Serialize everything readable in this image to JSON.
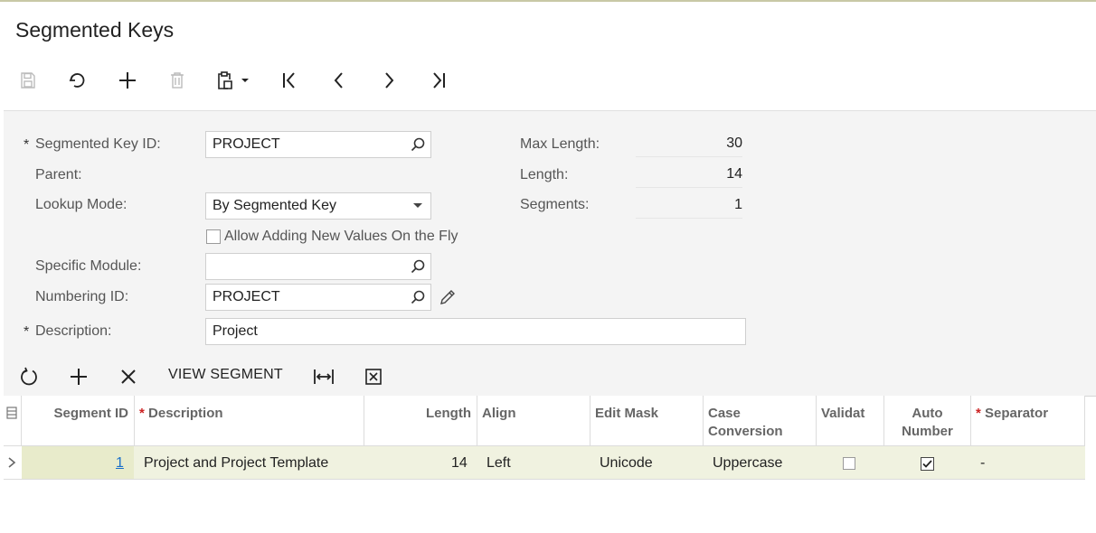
{
  "page": {
    "title": "Segmented Keys"
  },
  "toolbar": {
    "icons": [
      "save-icon",
      "undo-icon",
      "add-icon",
      "delete-icon",
      "clipboard-icon",
      "first-record-icon",
      "previous-record-icon",
      "next-record-icon",
      "last-record-icon"
    ]
  },
  "form": {
    "segmented_key_id": {
      "label": "Segmented Key ID:",
      "value": "PROJECT",
      "required_mark": "*"
    },
    "parent": {
      "label": "Parent:"
    },
    "lookup_mode": {
      "label": "Lookup Mode:",
      "value": "By Segmented Key"
    },
    "allow_adding": {
      "label": "Allow Adding New Values On the Fly",
      "checked": false
    },
    "specific_module": {
      "label": "Specific Module:",
      "value": ""
    },
    "numbering_id": {
      "label": "Numbering ID:",
      "value": "PROJECT"
    },
    "description": {
      "label": "Description:",
      "value": "Project",
      "required_mark": "*"
    },
    "max_length": {
      "label": "Max Length:",
      "value": "30"
    },
    "length": {
      "label": "Length:",
      "value": "14"
    },
    "segments": {
      "label": "Segments:",
      "value": "1"
    }
  },
  "grid_toolbar": {
    "view_segment_label": "VIEW SEGMENT"
  },
  "grid": {
    "columns": {
      "segment_id": "Segment ID",
      "description": "Description",
      "length": "Length",
      "align": "Align",
      "edit_mask": "Edit Mask",
      "case_conversion_1": "Case",
      "case_conversion_2": "Conversion",
      "validate": "Validat",
      "auto_number_1": "Auto",
      "auto_number_2": "Number",
      "separator": "Separator"
    },
    "required_mark": "*",
    "rows": [
      {
        "segment_id": "1",
        "description": "Project and Project Template",
        "length": "14",
        "align": "Left",
        "edit_mask": "Unicode",
        "case_conversion": "Uppercase",
        "validate": false,
        "auto_number": true,
        "separator": "-"
      }
    ]
  },
  "colors": {
    "selected_row": "#f0f2e0",
    "link": "#1a6fc9",
    "required": "#cc2222"
  }
}
